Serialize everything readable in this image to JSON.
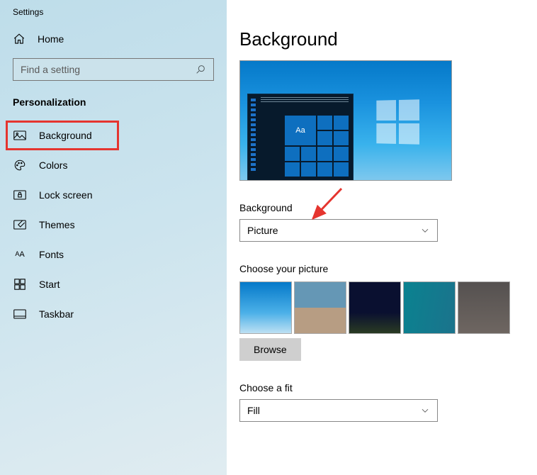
{
  "title": "Settings",
  "sidebar": {
    "home": "Home",
    "searchPlaceholder": "Find a setting",
    "section": "Personalization",
    "items": [
      {
        "label": "Background"
      },
      {
        "label": "Colors"
      },
      {
        "label": "Lock screen"
      },
      {
        "label": "Themes"
      },
      {
        "label": "Fonts"
      },
      {
        "label": "Start"
      },
      {
        "label": "Taskbar"
      }
    ]
  },
  "main": {
    "heading": "Background",
    "preview_tile_text": "Aa",
    "bg_label": "Background",
    "bg_value": "Picture",
    "choose_picture": "Choose your picture",
    "browse": "Browse",
    "choose_fit": "Choose a fit",
    "fit_value": "Fill"
  }
}
